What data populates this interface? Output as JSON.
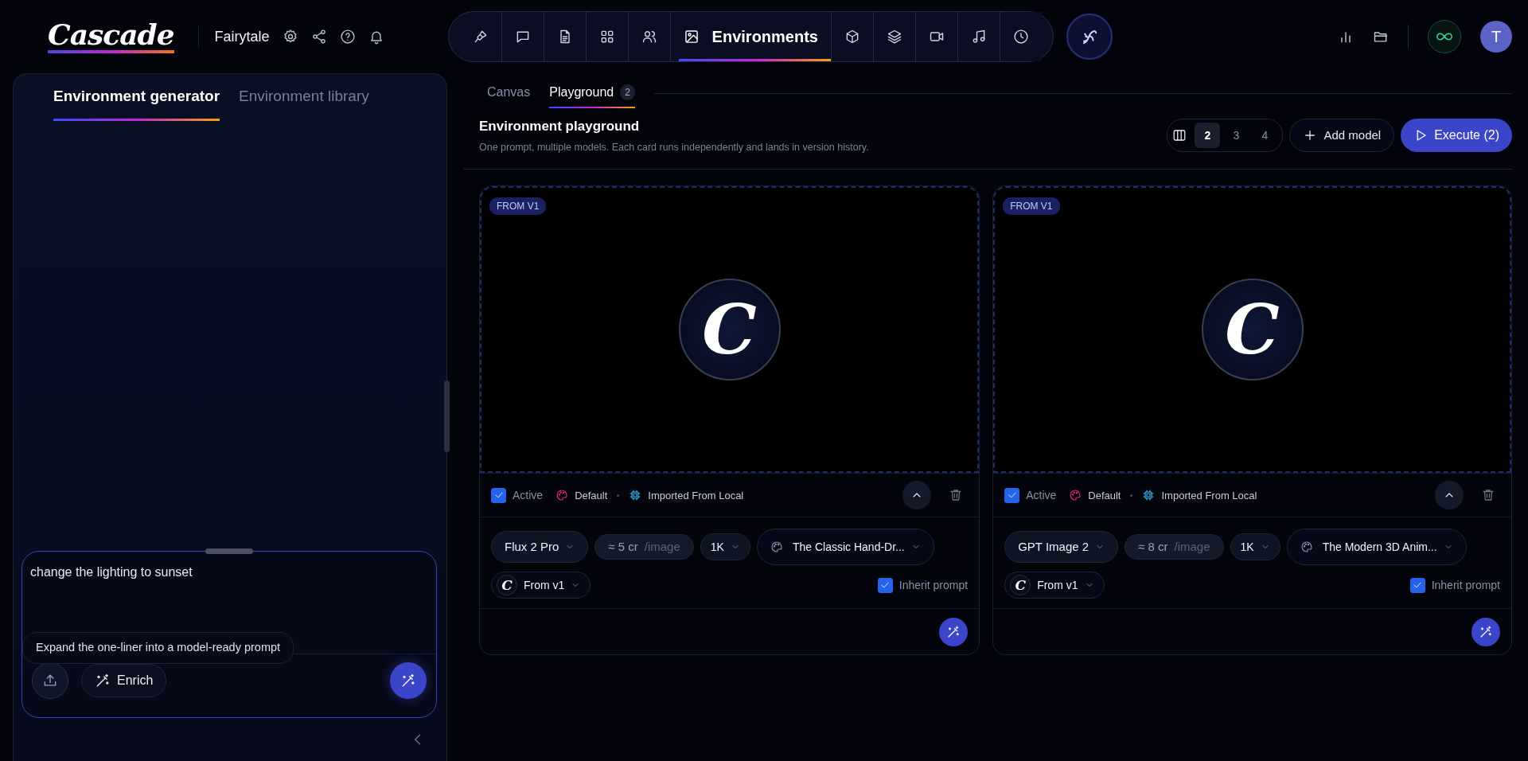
{
  "header": {
    "logo": "Cascade",
    "project": "Fairytale"
  },
  "nav": [
    {
      "selected": false
    },
    {
      "selected": false
    },
    {
      "selected": false
    },
    {
      "selected": false
    },
    {
      "selected": false
    },
    {
      "label": "Environments",
      "selected": true
    },
    {
      "selected": false
    },
    {
      "selected": false
    },
    {
      "selected": false
    },
    {
      "selected": false
    },
    {
      "selected": false
    }
  ],
  "top_right": {
    "avatar": "T"
  },
  "left_panel": {
    "tabs": [
      {
        "label": "Environment generator",
        "selected": true
      },
      {
        "label": "Environment library",
        "selected": false
      }
    ],
    "prompt": {
      "value": "change the lighting to sunset"
    },
    "tooltip": "Expand the one-liner into a model-ready prompt",
    "enrich": "Enrich"
  },
  "view_tabs": [
    {
      "label": "Canvas",
      "selected": false
    },
    {
      "label": "Playground",
      "count": "2",
      "selected": true
    }
  ],
  "playground": {
    "title": "Environment playground",
    "subtitle": "One prompt, multiple models. Each card runs independently and lands in version history.",
    "columns": [
      {
        "label": "2",
        "selected": true
      },
      {
        "label": "3",
        "selected": false
      },
      {
        "label": "4",
        "selected": false
      }
    ],
    "add_model": "Add model",
    "execute": "Execute (2)"
  },
  "cards": [
    {
      "badge": "FROM V1",
      "preview": "C",
      "active": {
        "label": "Active",
        "checked": true
      },
      "style": "Default",
      "source": "Imported From Local",
      "model": "Flux 2 Pro",
      "cost": "≈ 5 cr",
      "cost_unit": "/image",
      "resolution": "1K",
      "preset": "The Classic Hand-Dr...",
      "base_logo": "C",
      "base": "From v1",
      "inherit": {
        "label": "Inherit prompt",
        "checked": true
      }
    },
    {
      "badge": "FROM V1",
      "preview": "C",
      "active": {
        "label": "Active",
        "checked": true
      },
      "style": "Default",
      "source": "Imported From Local",
      "model": "GPT Image 2",
      "cost": "≈ 8 cr",
      "cost_unit": "/image",
      "resolution": "1K",
      "preset": "The Modern 3D Anim...",
      "base_logo": "C",
      "base": "From v1",
      "inherit": {
        "label": "Inherit prompt",
        "checked": true
      }
    }
  ]
}
